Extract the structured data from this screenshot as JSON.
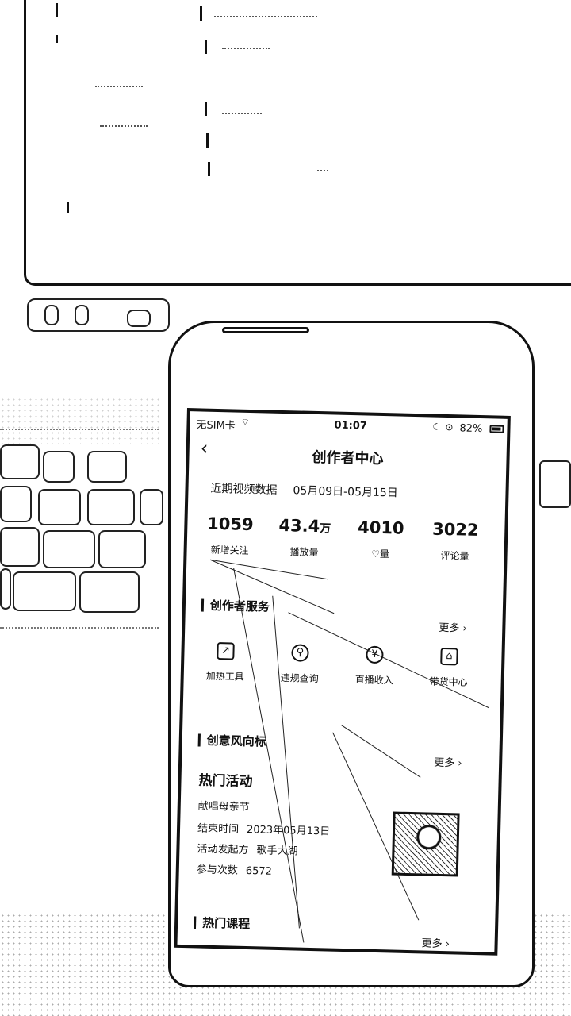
{
  "status_bar": {
    "carrier": "无SIM卡",
    "time": "01:07",
    "battery": "82%",
    "wifi_icon": "wifi-icon",
    "moon_icon": "moon-icon",
    "lock_icon": "orientation-lock-icon",
    "battery_icon": "battery-icon"
  },
  "nav": {
    "back": "‹",
    "title": "创作者中心"
  },
  "recent": {
    "label": "近期视频数据",
    "range": "05月09日-05月15日",
    "stats": [
      {
        "value": "1059",
        "unit": "",
        "label": "新增关注"
      },
      {
        "value": "43.4",
        "unit": "万",
        "label": "播放量"
      },
      {
        "value": "4010",
        "unit": "",
        "label": "♡量"
      },
      {
        "value": "3022",
        "unit": "",
        "label": "评论量"
      }
    ]
  },
  "creator_services": {
    "title": "创作者服务",
    "more": "更多 ›",
    "items": [
      {
        "label": "加热工具",
        "icon": "chart-up-icon"
      },
      {
        "label": "违规查询",
        "icon": "user-search-icon"
      },
      {
        "label": "直播收入",
        "icon": "yuan-coin-icon"
      },
      {
        "label": "带货中心",
        "icon": "shop-icon"
      }
    ]
  },
  "trend": {
    "title": "创意风向标",
    "more": "更多 ›"
  },
  "hot_activity": {
    "heading": "热门活动",
    "name": "献唱母亲节",
    "end_time_label": "结束时间",
    "end_time": "2023年05月13日",
    "organizer_label": "活动发起方",
    "organizer": "歌手大湖",
    "participants_label": "参与次数",
    "participants": "6572"
  },
  "hot_courses": {
    "title": "热门课程",
    "more": "更多 ›"
  },
  "colors": {
    "ink": "#111111",
    "paper": "#ffffff"
  }
}
